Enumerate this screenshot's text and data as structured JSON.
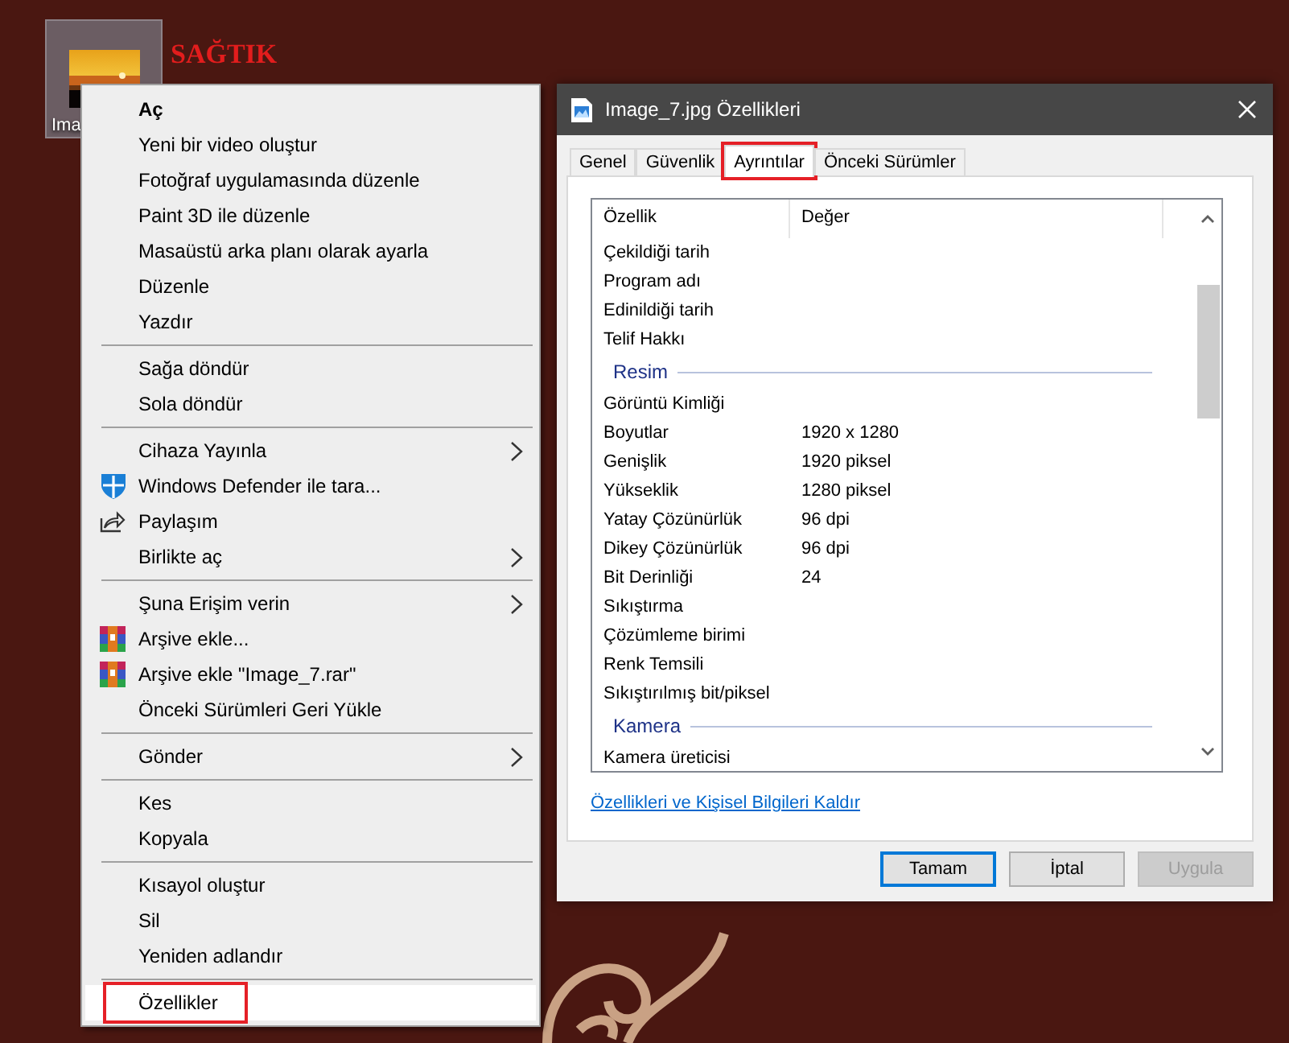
{
  "desktop_icon": {
    "label": "Ima",
    "selected": true
  },
  "annotation": "SAĞTIK",
  "context_menu": {
    "items": [
      {
        "kind": "text",
        "label": "Aç",
        "bold": true,
        "submenu": false,
        "selected": false,
        "boxed": false
      },
      {
        "kind": "text",
        "label": "Yeni bir video oluştur",
        "bold": false,
        "submenu": false,
        "selected": false,
        "boxed": false
      },
      {
        "kind": "text",
        "label": "Fotoğraf uygulamasında düzenle",
        "bold": false,
        "submenu": false,
        "selected": false,
        "boxed": false
      },
      {
        "kind": "text",
        "label": "Paint 3D ile düzenle",
        "bold": false,
        "submenu": false,
        "selected": false,
        "boxed": false
      },
      {
        "kind": "text",
        "label": "Masaüstü arka planı olarak ayarla",
        "bold": false,
        "submenu": false,
        "selected": false,
        "boxed": false
      },
      {
        "kind": "text",
        "label": "Düzenle",
        "bold": false,
        "submenu": false,
        "selected": false,
        "boxed": false
      },
      {
        "kind": "text",
        "label": "Yazdır",
        "bold": false,
        "submenu": false,
        "selected": false,
        "boxed": false
      },
      {
        "kind": "separator"
      },
      {
        "kind": "text",
        "label": "Sağa döndür",
        "bold": false,
        "submenu": false,
        "selected": false,
        "boxed": false
      },
      {
        "kind": "text",
        "label": "Sola döndür",
        "bold": false,
        "submenu": false,
        "selected": false,
        "boxed": false
      },
      {
        "kind": "separator"
      },
      {
        "kind": "text",
        "label": "Cihaza Yayınla",
        "bold": false,
        "submenu": true,
        "selected": false,
        "boxed": false
      },
      {
        "kind": "shield",
        "label": "Windows Defender ile tara...",
        "bold": false,
        "submenu": false,
        "selected": false,
        "boxed": false
      },
      {
        "kind": "share",
        "label": "Paylaşım",
        "bold": false,
        "submenu": false,
        "selected": false,
        "boxed": false
      },
      {
        "kind": "text",
        "label": "Birlikte aç",
        "bold": false,
        "submenu": true,
        "selected": false,
        "boxed": false
      },
      {
        "kind": "separator"
      },
      {
        "kind": "text",
        "label": "Şuna Erişim verin",
        "bold": false,
        "submenu": true,
        "selected": false,
        "boxed": false
      },
      {
        "kind": "archive",
        "label": "Arşive ekle...",
        "bold": false,
        "submenu": false,
        "selected": false,
        "boxed": false
      },
      {
        "kind": "archive",
        "label": "Arşive ekle \"Image_7.rar\"",
        "bold": false,
        "submenu": false,
        "selected": false,
        "boxed": false
      },
      {
        "kind": "text",
        "label": "Önceki Sürümleri Geri Yükle",
        "bold": false,
        "submenu": false,
        "selected": false,
        "boxed": false
      },
      {
        "kind": "separator"
      },
      {
        "kind": "text",
        "label": "Gönder",
        "bold": false,
        "submenu": true,
        "selected": false,
        "boxed": false
      },
      {
        "kind": "separator"
      },
      {
        "kind": "text",
        "label": "Kes",
        "bold": false,
        "submenu": false,
        "selected": false,
        "boxed": false
      },
      {
        "kind": "text",
        "label": "Kopyala",
        "bold": false,
        "submenu": false,
        "selected": false,
        "boxed": false
      },
      {
        "kind": "separator"
      },
      {
        "kind": "text",
        "label": "Kısayol oluştur",
        "bold": false,
        "submenu": false,
        "selected": false,
        "boxed": false
      },
      {
        "kind": "text",
        "label": "Sil",
        "bold": false,
        "submenu": false,
        "selected": false,
        "boxed": false
      },
      {
        "kind": "text",
        "label": "Yeniden adlandır",
        "bold": false,
        "submenu": false,
        "selected": false,
        "boxed": false
      },
      {
        "kind": "separator"
      },
      {
        "kind": "text",
        "label": "Özellikler",
        "bold": false,
        "submenu": false,
        "selected": true,
        "boxed": true
      }
    ]
  },
  "dialog": {
    "title": "Image_7.jpg Özellikleri",
    "tabs": [
      {
        "label": "Genel",
        "selected": false,
        "boxed": false
      },
      {
        "label": "Güvenlik",
        "selected": false,
        "boxed": false
      },
      {
        "label": "Ayrıntılar",
        "selected": true,
        "boxed": true
      },
      {
        "label": "Önceki Sürümler",
        "selected": false,
        "boxed": false
      }
    ],
    "columns": [
      "Özellik",
      "Değer"
    ],
    "rows": [
      {
        "kind": "property",
        "name": "Çekildiği tarih"
      },
      {
        "kind": "property",
        "name": "Program adı"
      },
      {
        "kind": "property",
        "name": "Edinildiği tarih"
      },
      {
        "kind": "property",
        "name": "Telif Hakkı"
      },
      {
        "kind": "group",
        "name": "Resim"
      },
      {
        "kind": "property",
        "name": "Görüntü Kimliği"
      },
      {
        "kind": "property",
        "name": "Boyutlar",
        "value": "1920 x 1280"
      },
      {
        "kind": "property",
        "name": "Genişlik",
        "value": "1920 piksel"
      },
      {
        "kind": "property",
        "name": "Yükseklik",
        "value": "1280 piksel"
      },
      {
        "kind": "property",
        "name": "Yatay Çözünürlük",
        "value": "96 dpi"
      },
      {
        "kind": "property",
        "name": "Dikey Çözünürlük",
        "value": "96 dpi"
      },
      {
        "kind": "property",
        "name": "Bit Derinliği",
        "value": "24"
      },
      {
        "kind": "property",
        "name": "Sıkıştırma"
      },
      {
        "kind": "property",
        "name": "Çözümleme birimi"
      },
      {
        "kind": "property",
        "name": "Renk Temsili"
      },
      {
        "kind": "property",
        "name": "Sıkıştırılmış bit/piksel"
      },
      {
        "kind": "group",
        "name": "Kamera"
      },
      {
        "kind": "property",
        "name": "Kamera üreticisi"
      }
    ],
    "link": "Özellikleri ve Kişisel Bilgileri Kaldır",
    "buttons": [
      {
        "label": "Tamam",
        "kind": "default",
        "disabled": false
      },
      {
        "label": "İptal",
        "kind": "normal",
        "disabled": false
      },
      {
        "label": "Uygula",
        "kind": "normal",
        "disabled": true
      }
    ]
  }
}
